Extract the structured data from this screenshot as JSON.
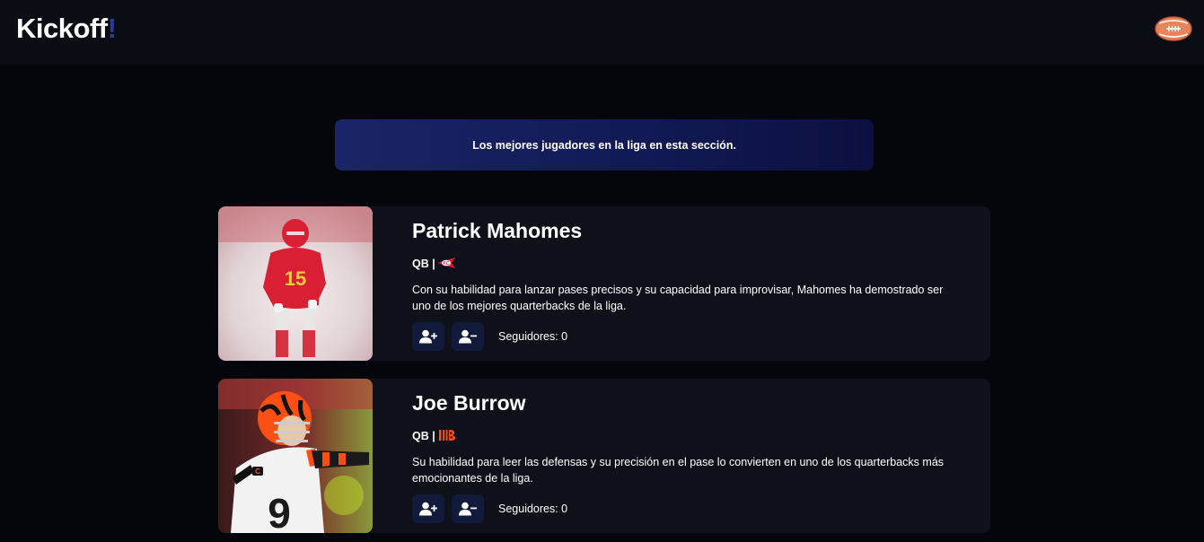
{
  "header": {
    "brand_main": "Kickoff",
    "brand_accent": "!",
    "ball_icon": "football-icon"
  },
  "banner": {
    "text": "Los mejores jugadores en la liga en esta sección."
  },
  "players": [
    {
      "name": "Patrick Mahomes",
      "position": "QB |",
      "team_logo": "chiefs-arrowhead-icon",
      "description": "Con su habilidad para lanzar pases precisos y su capacidad para improvisar, Mahomes ha demostrado ser uno de los mejores quarterbacks de la liga.",
      "followers_label": "Seguidores: 0",
      "follow_icon": "user-plus-icon",
      "unfollow_icon": "user-minus-icon",
      "jersey_number": "15"
    },
    {
      "name": "Joe Burrow",
      "position": "QB |",
      "team_logo": "bengals-b-icon",
      "description": "Su habilidad para leer las defensas y su precisión en el pase lo convierten en uno de los quarterbacks más emocionantes de la liga.",
      "followers_label": "Seguidores: 0",
      "follow_icon": "user-plus-icon",
      "unfollow_icon": "user-minus-icon",
      "jersey_number": "9"
    }
  ],
  "colors": {
    "page_bg": "#05060b",
    "nav_bg": "#0b0d15",
    "card_bg": "#0e1119",
    "button_bg": "#121a3c",
    "brand_accent": "#2b3a9e",
    "banner_start": "#1a2468",
    "banner_end": "#0c1040",
    "chiefs_red": "#e31837",
    "bengals_orange": "#fb4f14"
  }
}
